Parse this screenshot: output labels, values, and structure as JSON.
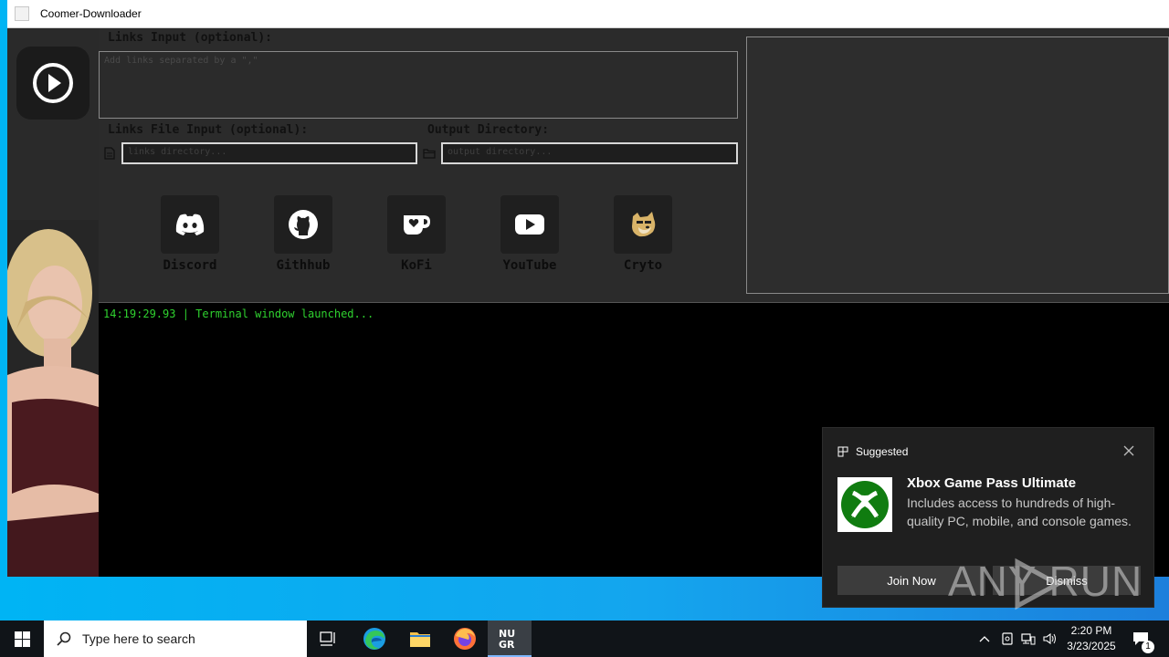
{
  "window": {
    "title": "Coomer-Downloader"
  },
  "form": {
    "links_label": "Links Input (optional):",
    "links_placeholder": "Add links separated by a \",\"",
    "file_label": "Links File Input (optional):",
    "file_placeholder": "links directory...",
    "output_label": "Output Directory:",
    "output_placeholder": "output directory..."
  },
  "social": [
    {
      "name": "Discord",
      "icon": "discord-icon"
    },
    {
      "name": "Githhub",
      "icon": "github-icon"
    },
    {
      "name": "KoFi",
      "icon": "kofi-icon"
    },
    {
      "name": "YouTube",
      "icon": "youtube-icon"
    },
    {
      "name": "Cryto",
      "icon": "doge-icon"
    }
  ],
  "terminal": {
    "line": "14:19:29.93 | Terminal window launched..."
  },
  "notification": {
    "header": "Suggested",
    "title": "Xbox Game Pass Ultimate",
    "body": "Includes access to hundreds of high-quality PC, mobile, and console games.",
    "join": "Join Now",
    "dismiss": "Dismiss"
  },
  "watermark": "ANY RUN",
  "taskbar": {
    "search_placeholder": "Type here to search",
    "time": "2:20 PM",
    "date": "3/23/2025",
    "notification_count": "1"
  },
  "colors": {
    "terminal_text": "#2fd12f",
    "desktop": "#1596e8",
    "accent": "#7fb7ff"
  }
}
